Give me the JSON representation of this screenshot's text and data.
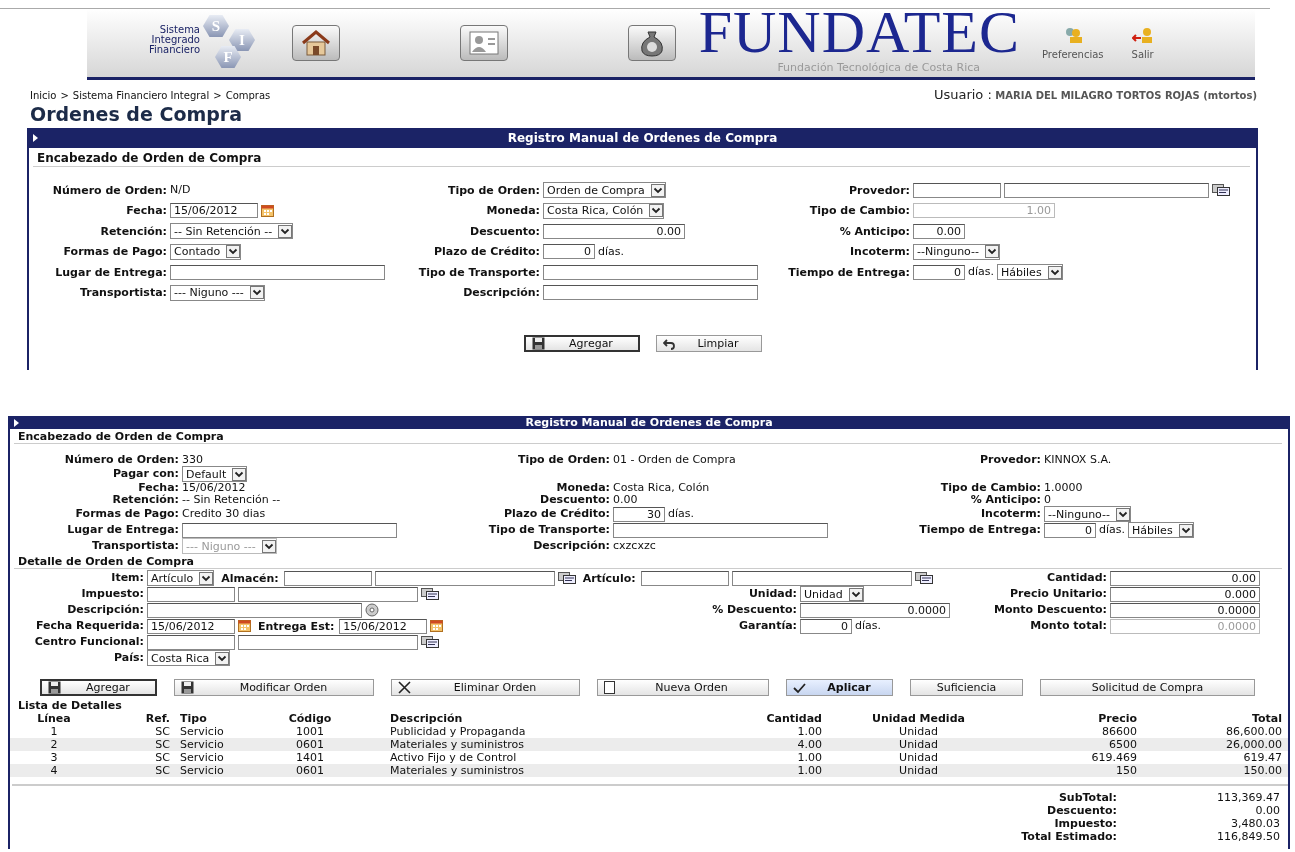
{
  "header": {
    "logo_lines": [
      "Sistema",
      "Integrado",
      "Financiero"
    ],
    "logo_letters": [
      "S",
      "I",
      "F"
    ],
    "brand": "FUNDATEC",
    "subtitle": "Fundación Tecnológica de Costa Rica",
    "actions": [
      {
        "label": "Preferencias"
      },
      {
        "label": "Salir"
      }
    ]
  },
  "breadcrumb": {
    "items": [
      "Inicio",
      "Sistema Financiero Integral",
      "Compras"
    ],
    "separators": [
      ">",
      ">"
    ]
  },
  "user": {
    "label": "Usuario :",
    "name": "MARIA DEL MILAGRO TORTOS ROJAS (mtortos)"
  },
  "page_title": "Ordenes de Compra",
  "panels": [
    {
      "title": "Registro Manual de Ordenes de Compra",
      "sections": [
        {
          "heading": "Encabezado de Orden de Compra",
          "rows": [
            [
              {
                "label": "Número de Orden:",
                "controls": [
                  {
                    "kind": "text",
                    "value": "N/D",
                    "disabled": false
                  }
                ]
              },
              {
                "label": "Tipo de Orden:",
                "controls": [
                  {
                    "kind": "select",
                    "value": "Orden de Compra",
                    "disabled": false
                  }
                ]
              },
              {
                "label": "Provedor:",
                "controls": [
                  {
                    "kind": "lookup",
                    "disabled": false
                  }
                ]
              }
            ],
            [
              {
                "label": "Fecha:",
                "controls": [
                  {
                    "kind": "date",
                    "value": "15/06/2012",
                    "disabled": false
                  }
                ]
              },
              {
                "label": "Moneda:",
                "controls": [
                  {
                    "kind": "select",
                    "value": "Costa Rica, Colón",
                    "disabled": false
                  }
                ]
              },
              {
                "label": "Tipo de Cambio:",
                "controls": [
                  {
                    "kind": "number",
                    "value": "1.00",
                    "disabled": true
                  }
                ]
              }
            ],
            [
              {
                "label": "Retención:",
                "controls": [
                  {
                    "kind": "select",
                    "value": "-- Sin Retención --",
                    "disabled": false
                  }
                ]
              },
              {
                "label": "Descuento:",
                "controls": [
                  {
                    "kind": "number",
                    "value": "0.00",
                    "disabled": false
                  }
                ]
              },
              {
                "label": "% Anticipo:",
                "controls": [
                  {
                    "kind": "count",
                    "value": "0.00",
                    "disabled": false
                  }
                ]
              }
            ],
            [
              {
                "label": "Formas de Pago:",
                "controls": [
                  {
                    "kind": "select",
                    "value": "Contado",
                    "disabled": false
                  }
                ]
              },
              {
                "label": "Plazo de Crédito:",
                "controls": [
                  {
                    "kind": "count",
                    "value": "0",
                    "disabled": false
                  },
                  {
                    "kind": "unit",
                    "value": "días.",
                    "disabled": false
                  }
                ]
              },
              {
                "label": "Incoterm:",
                "controls": [
                  {
                    "kind": "select",
                    "value": "--Ninguno--",
                    "disabled": false
                  }
                ]
              }
            ],
            [
              {
                "label": "Lugar de Entrega:",
                "controls": [
                  {
                    "kind": "input",
                    "disabled": false
                  }
                ]
              },
              {
                "label": "Tipo de Transporte:",
                "controls": [
                  {
                    "kind": "input",
                    "disabled": false
                  }
                ]
              },
              {
                "label": "Tiempo de Entrega:",
                "controls": [
                  {
                    "kind": "count",
                    "value": "0",
                    "disabled": false
                  },
                  {
                    "kind": "unit",
                    "value": "días.",
                    "disabled": false
                  },
                  {
                    "kind": "select",
                    "value": "Hábiles",
                    "disabled": false
                  }
                ]
              }
            ],
            [
              {
                "label": "Transportista:",
                "controls": [
                  {
                    "kind": "select",
                    "value": "--- Niguno ---",
                    "disabled": false
                  }
                ]
              },
              {
                "label": "Descripción:",
                "controls": [
                  {
                    "kind": "input",
                    "disabled": false
                  }
                ]
              },
              null
            ]
          ]
        }
      ],
      "buttons": [
        {
          "label": "Agregar",
          "kind": "focused"
        },
        {
          "label": "Limpiar",
          "kind": "plain"
        }
      ]
    },
    {
      "title": "Registro Manual de Ordenes de Compra",
      "sections": [
        {
          "heading": "Encabezado de Orden de Compra",
          "rows": [
            [
              {
                "label": "Número de Orden:",
                "controls": [
                  {
                    "kind": "text",
                    "value": "330",
                    "disabled": false
                  }
                ]
              },
              {
                "label": "Tipo de Orden:",
                "controls": [
                  {
                    "kind": "text",
                    "value": "01 - Orden de Compra",
                    "disabled": false
                  }
                ]
              },
              {
                "label": "Provedor:",
                "controls": [
                  {
                    "kind": "text",
                    "value": "KINNOX S.A.",
                    "disabled": false
                  }
                ]
              }
            ],
            [
              {
                "label": "Pagar con:",
                "controls": [
                  {
                    "kind": "select",
                    "value": "Default",
                    "disabled": false
                  }
                ]
              },
              null,
              null
            ],
            [
              {
                "label": "Fecha:",
                "controls": [
                  {
                    "kind": "text",
                    "value": "15/06/2012",
                    "disabled": false
                  }
                ]
              },
              {
                "label": "Moneda:",
                "controls": [
                  {
                    "kind": "text",
                    "value": "Costa Rica, Colón",
                    "disabled": false
                  }
                ]
              },
              {
                "label": "Tipo de Cambio:",
                "controls": [
                  {
                    "kind": "text",
                    "value": "1.0000",
                    "disabled": false
                  }
                ]
              }
            ],
            [
              {
                "label": "Retención:",
                "controls": [
                  {
                    "kind": "text",
                    "value": "-- Sin Retención --",
                    "disabled": false
                  }
                ]
              },
              {
                "label": "Descuento:",
                "controls": [
                  {
                    "kind": "text",
                    "value": "0.00",
                    "disabled": false
                  }
                ]
              },
              {
                "label": "% Anticipo:",
                "controls": [
                  {
                    "kind": "text",
                    "value": "0",
                    "disabled": false
                  }
                ]
              }
            ],
            [
              {
                "label": "Formas de Pago:",
                "controls": [
                  {
                    "kind": "text",
                    "value": "Credito 30 dias",
                    "disabled": false
                  }
                ]
              },
              {
                "label": "Plazo de Crédito:",
                "controls": [
                  {
                    "kind": "count",
                    "value": "30",
                    "disabled": false
                  },
                  {
                    "kind": "unit",
                    "value": "días.",
                    "disabled": false
                  }
                ]
              },
              {
                "label": "Incoterm:",
                "controls": [
                  {
                    "kind": "select",
                    "value": "--Ninguno--",
                    "disabled": false
                  }
                ]
              }
            ],
            [
              {
                "label": "Lugar de Entrega:",
                "controls": [
                  {
                    "kind": "input",
                    "disabled": false
                  }
                ]
              },
              {
                "label": "Tipo de Transporte:",
                "controls": [
                  {
                    "kind": "input",
                    "disabled": false
                  }
                ]
              },
              {
                "label": "Tiempo de Entrega:",
                "controls": [
                  {
                    "kind": "count",
                    "value": "0",
                    "disabled": false
                  },
                  {
                    "kind": "unit",
                    "value": "días.",
                    "disabled": false
                  },
                  {
                    "kind": "select",
                    "value": "Hábiles",
                    "disabled": false
                  }
                ]
              }
            ],
            [
              {
                "label": "Transportista:",
                "controls": [
                  {
                    "kind": "select",
                    "value": "--- Niguno ---",
                    "disabled": true
                  }
                ]
              },
              {
                "label": "Descripción:",
                "controls": [
                  {
                    "kind": "text",
                    "value": "cxzcxzc",
                    "disabled": false
                  }
                ]
              },
              null
            ]
          ]
        },
        {
          "heading": "Detalle de Orden de Compra",
          "rows": [
            [
              {
                "label": "Item:",
                "controls": [
                  {
                    "kind": "select",
                    "value": "Artículo",
                    "disabled": false
                  },
                  {
                    "kind": "label",
                    "value": "Almacén:",
                    "disabled": false
                  },
                  {
                    "kind": "lookup",
                    "disabled": false
                  },
                  {
                    "kind": "label",
                    "value": "Artículo:",
                    "disabled": false
                  },
                  {
                    "kind": "lookup",
                    "disabled": false
                  }
                ]
              },
              null,
              {
                "label": "Cantidad:",
                "controls": [
                  {
                    "kind": "number",
                    "value": "0.00",
                    "disabled": false
                  }
                ]
              }
            ],
            [
              {
                "label": "Impuesto:",
                "controls": [
                  {
                    "kind": "lookup",
                    "disabled": false
                  }
                ]
              },
              {
                "label": "Unidad:",
                "controls": [
                  {
                    "kind": "select",
                    "value": "Unidad",
                    "disabled": false
                  }
                ]
              },
              {
                "label": "Precio Unitario:",
                "controls": [
                  {
                    "kind": "number",
                    "value": "0.000",
                    "disabled": false
                  }
                ]
              }
            ],
            [
              {
                "label": "Descripción:",
                "controls": [
                  {
                    "kind": "input",
                    "disabled": false
                  },
                  {
                    "kind": "attach",
                    "disabled": false
                  }
                ]
              },
              {
                "label": "% Descuento:",
                "controls": [
                  {
                    "kind": "number",
                    "value": "0.0000",
                    "disabled": false
                  }
                ]
              },
              {
                "label": "Monto Descuento:",
                "controls": [
                  {
                    "kind": "number",
                    "value": "0.0000",
                    "disabled": false
                  }
                ]
              }
            ],
            [
              {
                "label": "Fecha Requerida:",
                "controls": [
                  {
                    "kind": "date",
                    "value": "15/06/2012",
                    "disabled": false
                  },
                  {
                    "kind": "label",
                    "value": "Entrega Est:",
                    "disabled": false
                  },
                  {
                    "kind": "date",
                    "value": "15/06/2012",
                    "disabled": false
                  }
                ]
              },
              {
                "label": "Garantía:",
                "controls": [
                  {
                    "kind": "count",
                    "value": "0",
                    "disabled": false
                  },
                  {
                    "kind": "unit",
                    "value": "días.",
                    "disabled": false
                  }
                ]
              },
              {
                "label": "Monto total:",
                "controls": [
                  {
                    "kind": "number",
                    "value": "0.0000",
                    "disabled": true
                  }
                ]
              }
            ],
            [
              {
                "label": "Centro Funcional:",
                "controls": [
                  {
                    "kind": "lookup",
                    "disabled": false
                  }
                ]
              },
              null,
              null
            ],
            [
              {
                "label": "País:",
                "controls": [
                  {
                    "kind": "select",
                    "value": "Costa Rica",
                    "disabled": false
                  }
                ]
              },
              null,
              null
            ]
          ]
        }
      ],
      "buttons": [
        {
          "label": "Agregar",
          "kind": "focused"
        },
        {
          "label": "Modificar Orden",
          "kind": "plain"
        },
        {
          "label": "Eliminar Orden",
          "kind": "plain"
        },
        {
          "label": "Nueva Orden",
          "kind": "plain"
        },
        {
          "label": "Aplicar",
          "kind": "primary"
        },
        {
          "label": "Suficiencia",
          "kind": "plain"
        },
        {
          "label": "Solicitud de Compra",
          "kind": "plain"
        }
      ],
      "details": {
        "heading": "Lista de Detalles",
        "columns": [
          "Línea",
          "Ref.",
          "Tipo",
          "Código",
          "Descripción",
          "Cantidad",
          "Unidad Medida",
          "Precio",
          "Total"
        ],
        "rows": [
          [
            "1",
            "SC",
            "Servicio",
            "1001",
            "Publicidad y Propaganda",
            "1.00",
            "Unidad",
            "86600",
            "86,600.00"
          ],
          [
            "2",
            "SC",
            "Servicio",
            "0601",
            "Materiales y suministros",
            "4.00",
            "Unidad",
            "6500",
            "26,000.00"
          ],
          [
            "3",
            "SC",
            "Servicio",
            "1401",
            "Activo Fijo y de Control",
            "1.00",
            "Unidad",
            "619.469",
            "619.47"
          ],
          [
            "4",
            "SC",
            "Servicio",
            "0601",
            "Materiales y suministros",
            "1.00",
            "Unidad",
            "150",
            "150.00"
          ]
        ]
      },
      "totals": [
        {
          "label": "SubTotal:",
          "value": "113,369.47"
        },
        {
          "label": "Descuento:",
          "value": "0.00"
        },
        {
          "label": "Impuesto:",
          "value": "3,480.03"
        },
        {
          "label": "Total Estimado:",
          "value": "116,849.50"
        }
      ]
    }
  ]
}
